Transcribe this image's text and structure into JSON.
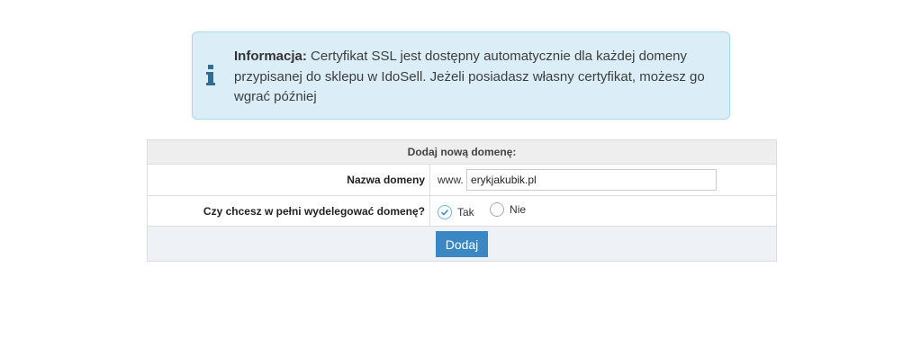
{
  "info": {
    "lead": "Informacja:",
    "text": "Certyfikat SSL jest dostępny automatycznie dla każdej domeny przypisanej do sklepu w IdoSell. Jeżeli posiadasz własny certyfikat, możesz go wgrać później",
    "icon": "info-icon"
  },
  "form": {
    "header": "Dodaj nową domenę:",
    "domain_label": "Nazwa domeny",
    "domain_prefix": "www.",
    "domain_value": "erykjakubik.pl",
    "delegate_label": "Czy chcesz w pełni wydelegować domenę?",
    "options": [
      {
        "label": "Tak",
        "checked": true
      },
      {
        "label": "Nie",
        "checked": false
      }
    ],
    "submit_label": "Dodaj"
  },
  "colors": {
    "accent": "#3b87c4",
    "info_bg": "#dbeef7",
    "info_border": "#a9d7ec",
    "icon": "#2f6e94"
  }
}
